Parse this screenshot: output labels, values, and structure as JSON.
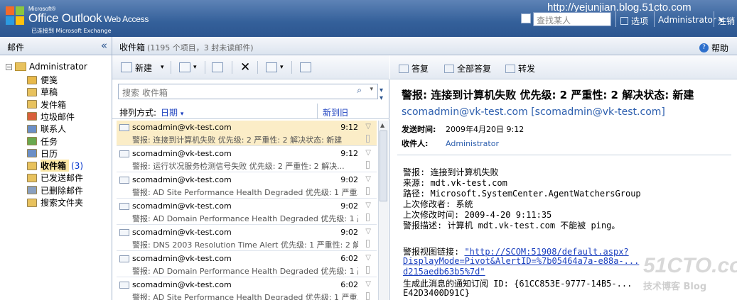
{
  "banner": {
    "brand_small": "Microsoft®",
    "brand_office": "Office Outlook",
    "brand_owa": "Web Access",
    "brand_sub": "已连接到 Microsoft Exchange",
    "search_people_placeholder": "查找某人",
    "options_label": "选项",
    "user_label": "Administrator",
    "logout_label": "注销",
    "watermark": "http://yejunjian.blog.51cto.com"
  },
  "left": {
    "title": "邮件",
    "root": "Administrator",
    "folders": [
      {
        "label": "便笺",
        "color": "#e8b94a"
      },
      {
        "label": "草稿",
        "color": "#e8c25e"
      },
      {
        "label": "发件箱",
        "color": "#e8c25e"
      },
      {
        "label": "垃圾邮件",
        "color": "#d9603b"
      },
      {
        "label": "联系人",
        "color": "#6b8fc7"
      },
      {
        "label": "任务",
        "color": "#6aa84f"
      },
      {
        "label": "日历",
        "color": "#6b8fc7"
      },
      {
        "label": "收件箱",
        "color": "#e8c25e",
        "count": "(3)"
      },
      {
        "label": "已发送邮件",
        "color": "#e8c25e"
      },
      {
        "label": "已删除邮件",
        "color": "#8aa0c0"
      },
      {
        "label": "搜索文件夹",
        "color": "#e8c25e"
      }
    ]
  },
  "inbox": {
    "title": "收件箱",
    "count": "(1195 个项目，3 封未读邮件)",
    "toolbar": {
      "new_label": "新建"
    },
    "search_placeholder": "搜索 收件箱",
    "sort_label": "排列方式:",
    "sort_field": "日期",
    "sort_order": "新到旧",
    "messages": [
      {
        "from": "scomadmin@vk-test.com",
        "time": "9:12",
        "subject": "警报: 连接到计算机失败 优先级: 2 严重性: 2 解决状态: 新建"
      },
      {
        "from": "scomadmin@vk-test.com",
        "time": "9:12",
        "subject": "警报: 运行状况服务检测信号失败 优先级: 2 严重性: 2 解决..."
      },
      {
        "from": "scomadmin@vk-test.com",
        "time": "9:02",
        "subject": "警报: AD Site Performance Health Degraded 优先级: 1 严重..."
      },
      {
        "from": "scomadmin@vk-test.com",
        "time": "9:02",
        "subject": "警报: AD Domain Performance Health Degraded 优先级: 1 严重..."
      },
      {
        "from": "scomadmin@vk-test.com",
        "time": "9:02",
        "subject": "警报: DNS 2003 Resolution Time Alert 优先级: 1 严重性: 2 解决..."
      },
      {
        "from": "scomadmin@vk-test.com",
        "time": "6:02",
        "subject": "警报: AD Domain Performance Health Degraded 优先级: 1 严重..."
      },
      {
        "from": "scomadmin@vk-test.com",
        "time": "6:02",
        "subject": "警报: AD Site Performance Health Degraded 优先级: 1 严重..."
      }
    ]
  },
  "reading": {
    "reply_label": "答复",
    "reply_all_label": "全部答复",
    "forward_label": "转发",
    "help_label": "帮助",
    "subject": "警报: 连接到计算机失败 优先级: 2 严重性: 2 解决状态: 新建",
    "from": "scomadmin@vk-test.com [scomadmin@vk-test.com]",
    "sent_label": "发送时间:",
    "sent_value": "2009年4月20日 9:12",
    "to_label": "收件人:",
    "to_value": "Administrator",
    "body": [
      "警报: 连接到计算机失败",
      "来源: mdt.vk-test.com",
      "路径: Microsoft.SystemCenter.AgentWatchersGroup",
      "上次修改者: 系统",
      "上次修改时间: 2009-4-20 9:11:35",
      "警报描述: 计算机 mdt.vk-test.com 不能被 ping。"
    ],
    "link_label": "警报视图链接: ",
    "link_line1": "\"http://SCOM:51908/default.aspx?",
    "link_line2": "DisplayMode=Pivot&AlertID=%7b05464a7a-e88a-...",
    "link_line3": "d215aedb63b5%7d\"",
    "sub_line1": "生成此消息的通知订阅 ID: {61CC853E-9777-14B5-...",
    "sub_line2": "E42D3400D91C}"
  },
  "overlay": {
    "logo": "51CTO.com",
    "logo_sub": "技术博客 Blog"
  }
}
